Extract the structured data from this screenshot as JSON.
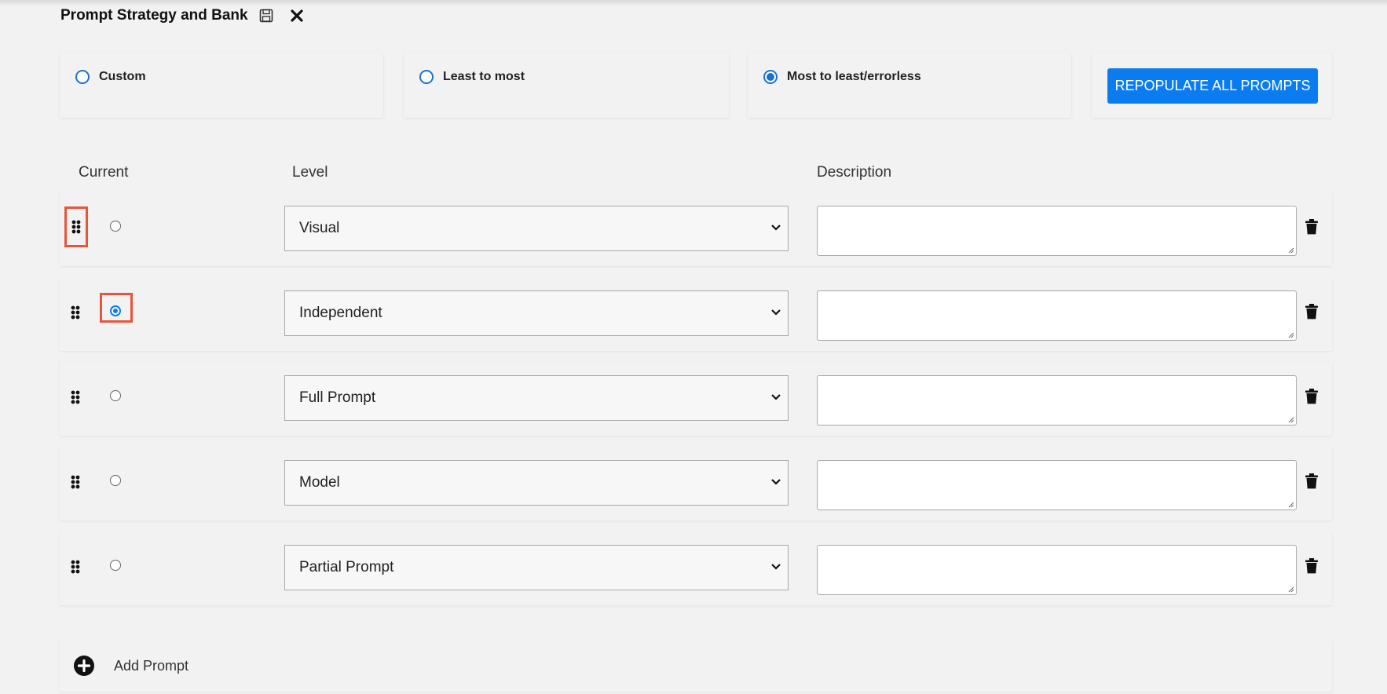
{
  "header": {
    "title": "Prompt Strategy and Bank",
    "save_icon": "save-icon",
    "close_icon": "close-icon"
  },
  "strategies": [
    {
      "label": "Custom",
      "selected": false
    },
    {
      "label": "Least to most",
      "selected": false
    },
    {
      "label": "Most to least/errorless",
      "selected": true
    }
  ],
  "repopulate_button": "REPOPULATE ALL PROMPTS",
  "columns": {
    "current": "Current",
    "level": "Level",
    "description": "Description"
  },
  "prompts": [
    {
      "level": "Visual",
      "current": false,
      "description": ""
    },
    {
      "level": "Independent",
      "current": true,
      "description": ""
    },
    {
      "level": "Full Prompt",
      "current": false,
      "description": ""
    },
    {
      "level": "Model",
      "current": false,
      "description": ""
    },
    {
      "level": "Partial Prompt",
      "current": false,
      "description": ""
    }
  ],
  "add_prompt": "Add Prompt",
  "colors": {
    "accent": "#0a7cf0",
    "highlight": "#e8553c",
    "background": "#f2f2f2"
  }
}
